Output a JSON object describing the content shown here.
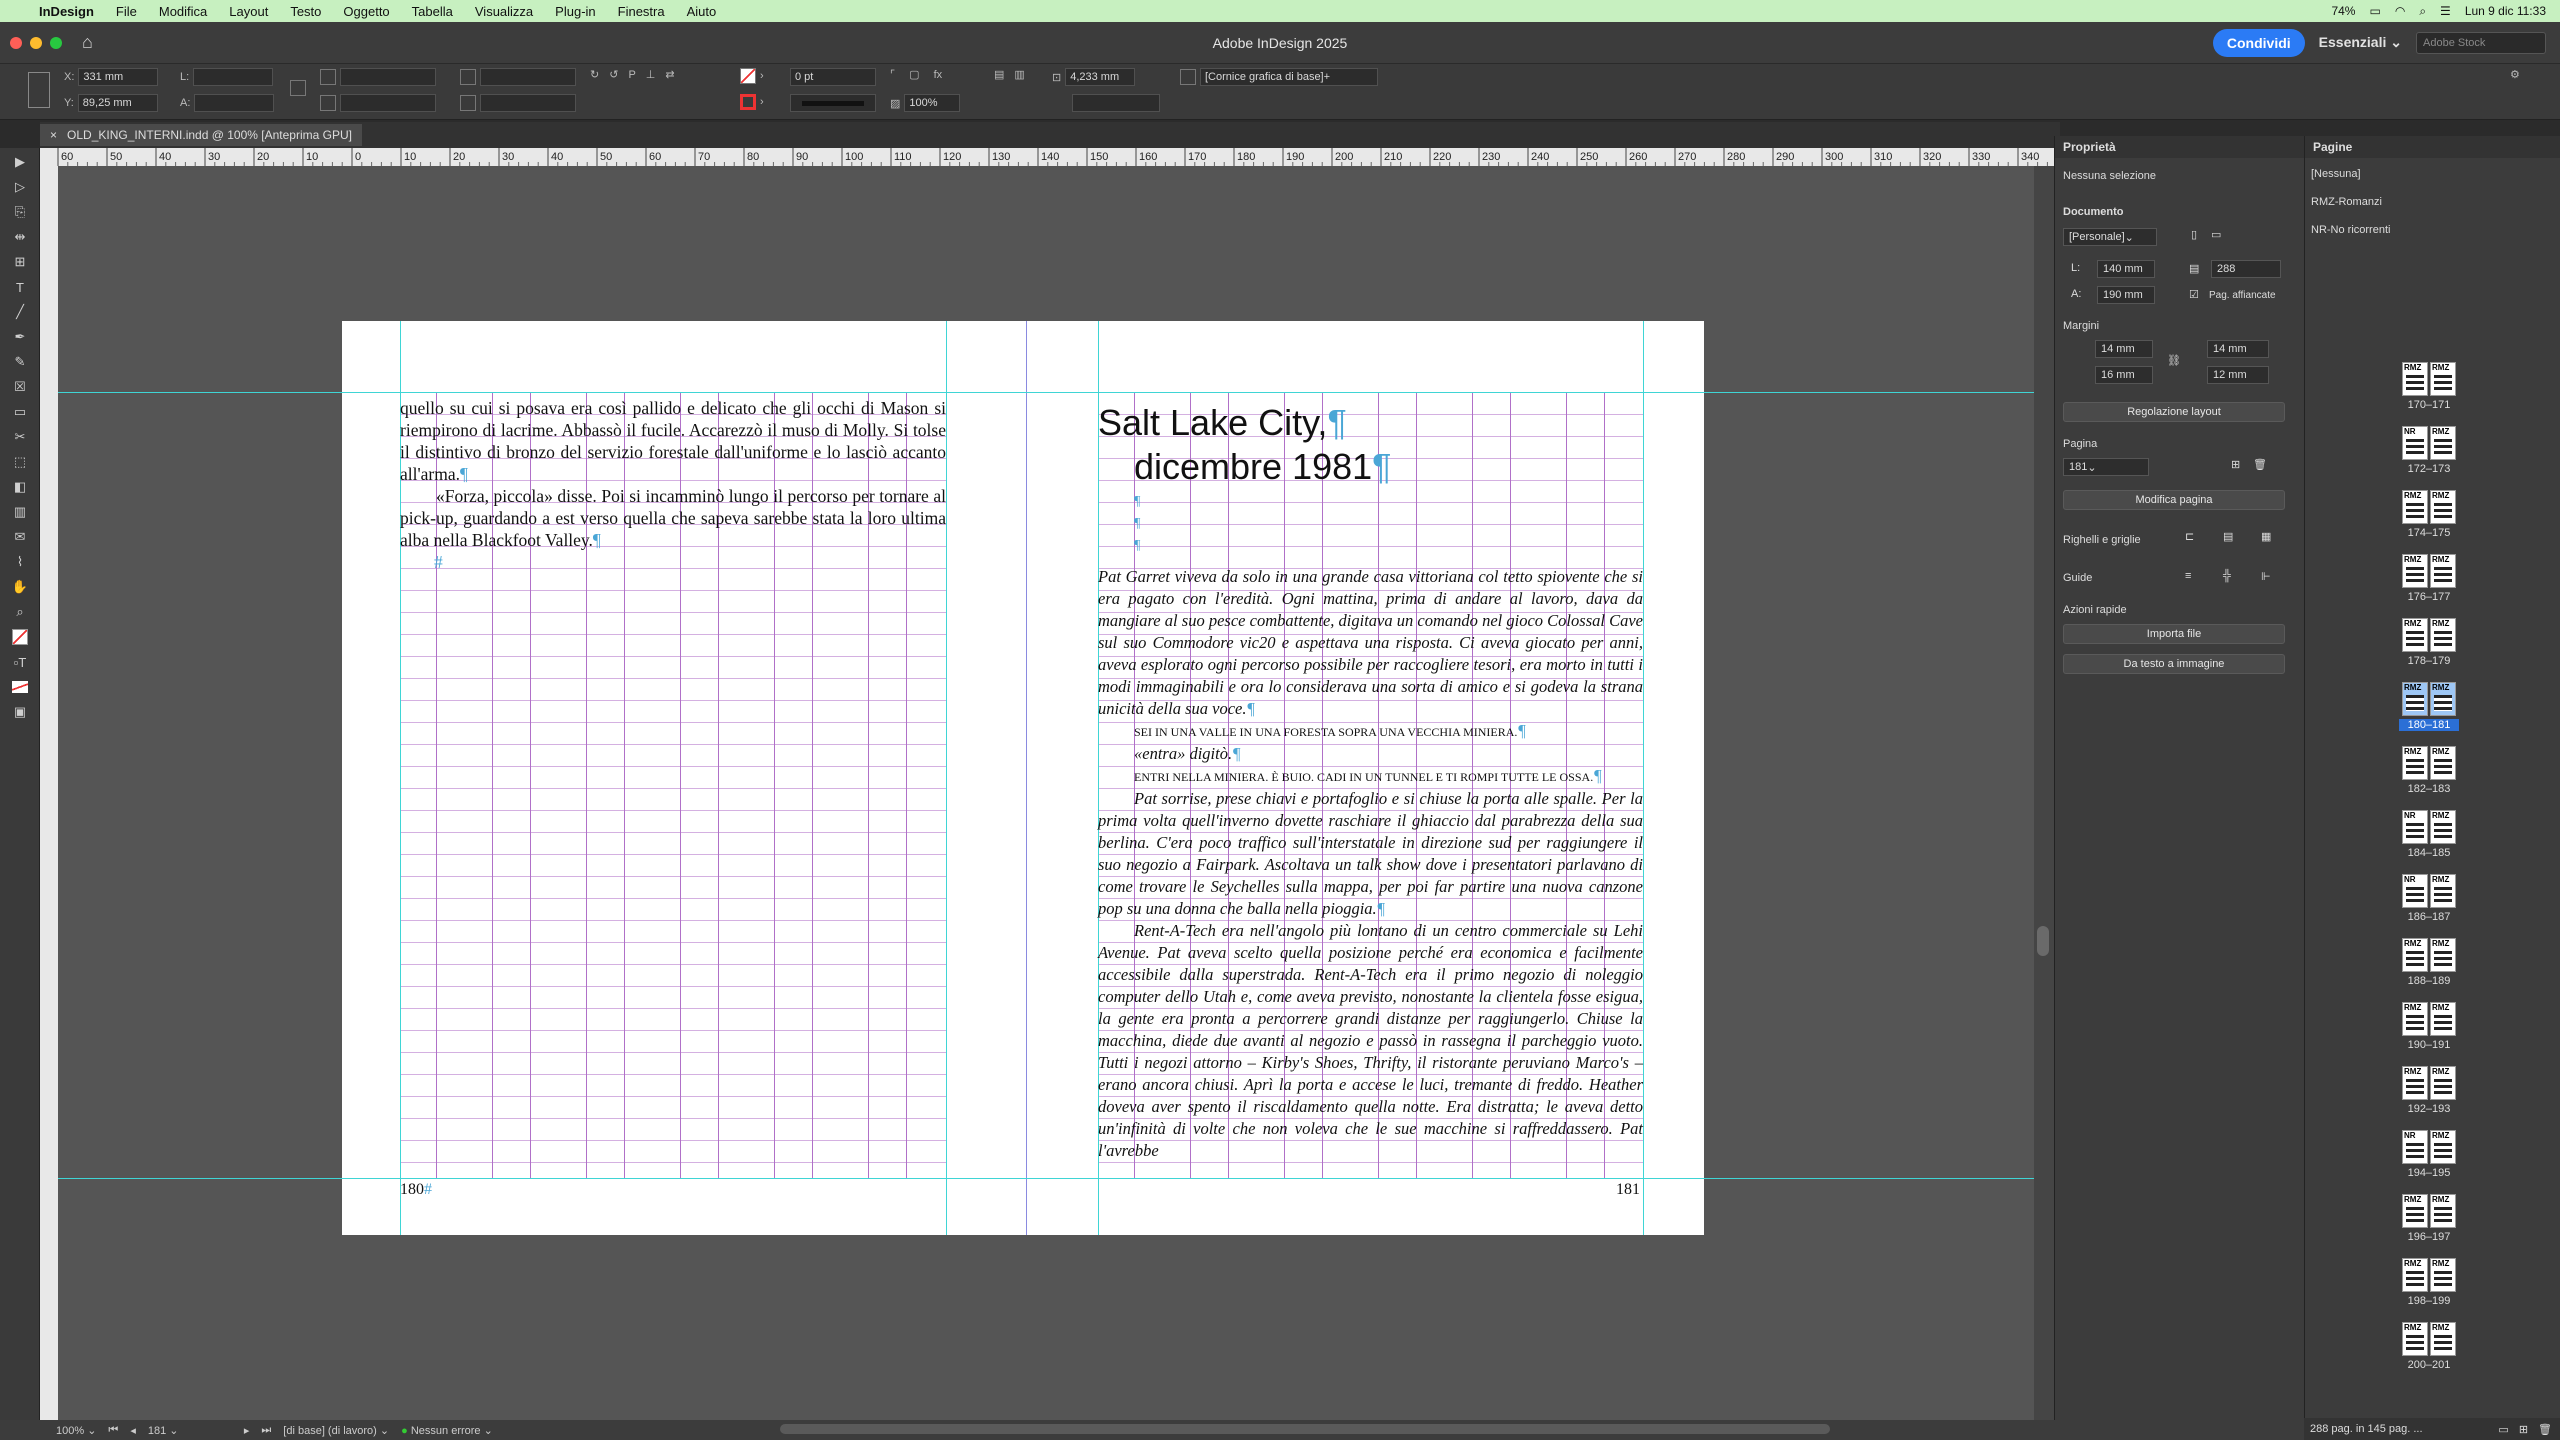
{
  "menubar": {
    "app": "InDesign",
    "items": [
      "File",
      "Modifica",
      "Layout",
      "Testo",
      "Oggetto",
      "Tabella",
      "Visualizza",
      "Plug-in",
      "Finestra",
      "Aiuto"
    ],
    "battery": "74%",
    "datetime": "Lun 9 dic  11:33"
  },
  "titlebar": {
    "title": "Adobe InDesign 2025",
    "share": "Condividi",
    "workspace": "Essenziali",
    "stock_placeholder": "Adobe Stock"
  },
  "control": {
    "x": "331 mm",
    "y": "89,25 mm",
    "stroke": "0 pt",
    "ref_size": "4,233 mm",
    "scale": "100%",
    "object_style": "[Cornice grafica di base]+"
  },
  "doc_tab": "OLD_KING_INTERNI.indd @ 100% [Anteprima GPU]",
  "ruler_labels": [
    "60",
    "50",
    "40",
    "30",
    "20",
    "10",
    "0",
    "10",
    "20",
    "30",
    "40",
    "50",
    "60",
    "70",
    "80",
    "90",
    "100",
    "110",
    "120",
    "130",
    "140",
    "150",
    "160",
    "170",
    "180",
    "190",
    "200",
    "210",
    "220",
    "230",
    "240",
    "250",
    "260",
    "270",
    "280",
    "290",
    "300",
    "310",
    "320",
    "330",
    "340"
  ],
  "left_page": {
    "text": "quello su cui si posava era così pallido e delicato che gli occhi di Mason si riempirono di lacrime. Abbassò il fucile. Accarezzò il muso di Molly. Si tolse il distintivo di bronzo del servizio forestale dall'uniforme e lo lasciò accanto all'arma.",
    "text2": "«Forza, piccola» disse. Poi si incamminò lungo il percorso per tornare al pick-up, guardando a est verso quella che sapeva sarebbe stata la loro ultima alba nella Blackfoot Valley.",
    "folio": "180"
  },
  "right_page": {
    "heading1": "Salt Lake City,",
    "heading2": "dicembre 1981",
    "p1": "Pat Garret viveva da solo in una grande casa vittoriana col tetto spiovente che si era pagato con l'eredità. Ogni mattina, prima di andare al lavoro, dava da mangiare al suo pesce combattente, digitava un comando nel gioco Colossal Cave sul suo Commodore vic20 e aspettava una risposta. Ci aveva giocato per anni, aveva esplorato ogni percorso possibile per raccogliere tesori, era morto in tutti i modi immaginabili e ora lo considerava una sorta di amico e si godeva la strana unicità della sua voce.",
    "p2": "SEI IN UNA VALLE IN UNA FORESTA SOPRA UNA VECCHIA MINIERA.",
    "p3": "«entra» digitò.",
    "p4": "ENTRI NELLA MINIERA. È BUIO. CADI IN UN TUNNEL E TI ROMPI TUTTE LE OSSA.",
    "p5": "Pat sorrise, prese chiavi e portafoglio e si chiuse la porta alle spalle. Per la prima volta quell'inverno dovette raschiare il ghiaccio dal parabrezza della sua berlina. C'era poco traffico sull'interstatale in direzione sud per raggiungere il suo negozio a Fairpark. Ascoltava un talk show dove i presentatori parlavano di come trovare le Seychelles sulla mappa, per poi far partire una nuova canzone pop su una donna che balla nella pioggia.",
    "p6": "Rent-A-Tech era nell'angolo più lontano di un centro commerciale su Lehi Avenue. Pat aveva scelto quella posizione perché era economica e facilmente accessibile dalla superstrada. Rent-A-Tech era il primo negozio di noleggio computer dello Utah e, come aveva previsto, nonostante la clientela fosse esigua, la gente era pronta a percorrere grandi distanze per raggiungerlo. Chiuse la macchina, diede due avanti al negozio e passò in rassegna il parcheggio vuoto. Tutti i negozi attorno – Kirby's Shoes, Thrifty, il ristorante peruviano Marco's – erano ancora chiusi. Aprì la porta e accese le luci, tremante di freddo. Heather doveva aver spento il riscaldamento quella notte. Era distratta; le aveva detto un'infinità di volte che non voleva che le sue macchine si raffreddassero. Pat l'avrebbe",
    "folio": "181"
  },
  "properties": {
    "title": "Proprietà",
    "selection": "Nessuna selezione",
    "doc_section": "Documento",
    "preset": "[Personale]",
    "width_label": "L:",
    "width": "140 mm",
    "height_label": "A:",
    "height": "190 mm",
    "pages_count": "288",
    "facing_pages": "Pag. affiancate",
    "margins_label": "Margini",
    "m_top": "14 mm",
    "m_bottom": "16 mm",
    "m_inside": "14 mm",
    "m_outside": "12 mm",
    "layout_adjust": "Regolazione layout",
    "page_section": "Pagina",
    "page_value": "181",
    "edit_page": "Modifica pagina",
    "rulers_grids": "Righelli e griglie",
    "guides": "Guide",
    "quick_actions": "Azioni rapide",
    "import_file": "Importa file",
    "text_to_image": "Da testo a immagine"
  },
  "pages_panel": {
    "title": "Pagine",
    "masters": [
      "[Nessuna]",
      "RMZ-Romanzi",
      "NR-No ricorrenti"
    ],
    "spreads": [
      {
        "label": "170–171",
        "left": "RMZ",
        "right": "RMZ"
      },
      {
        "label": "172–173",
        "left": "NR",
        "right": "RMZ"
      },
      {
        "label": "174–175",
        "left": "RMZ",
        "right": "RMZ"
      },
      {
        "label": "176–177",
        "left": "RMZ",
        "right": "RMZ"
      },
      {
        "label": "178–179",
        "left": "RMZ",
        "right": "RMZ"
      },
      {
        "label": "180–181",
        "left": "RMZ",
        "right": "RMZ"
      },
      {
        "label": "182–183",
        "left": "RMZ",
        "right": "RMZ"
      },
      {
        "label": "184–185",
        "left": "NR",
        "right": "RMZ"
      },
      {
        "label": "186–187",
        "left": "NR",
        "right": "RMZ"
      },
      {
        "label": "188–189",
        "left": "RMZ",
        "right": "RMZ"
      },
      {
        "label": "190–191",
        "left": "RMZ",
        "right": "RMZ"
      },
      {
        "label": "192–193",
        "left": "RMZ",
        "right": "RMZ"
      },
      {
        "label": "194–195",
        "left": "NR",
        "right": "RMZ"
      },
      {
        "label": "196–197",
        "left": "RMZ",
        "right": "RMZ"
      },
      {
        "label": "198–199",
        "left": "RMZ",
        "right": "RMZ"
      },
      {
        "label": "200–201",
        "left": "RMZ",
        "right": "RMZ"
      }
    ],
    "selected_spread": "180–181",
    "footer": "288 pag. in 145 pag. ..."
  },
  "statusbar": {
    "zoom": "100%",
    "page": "181",
    "master": "[di base] (di lavoro)",
    "errors": "Nessun errore"
  }
}
